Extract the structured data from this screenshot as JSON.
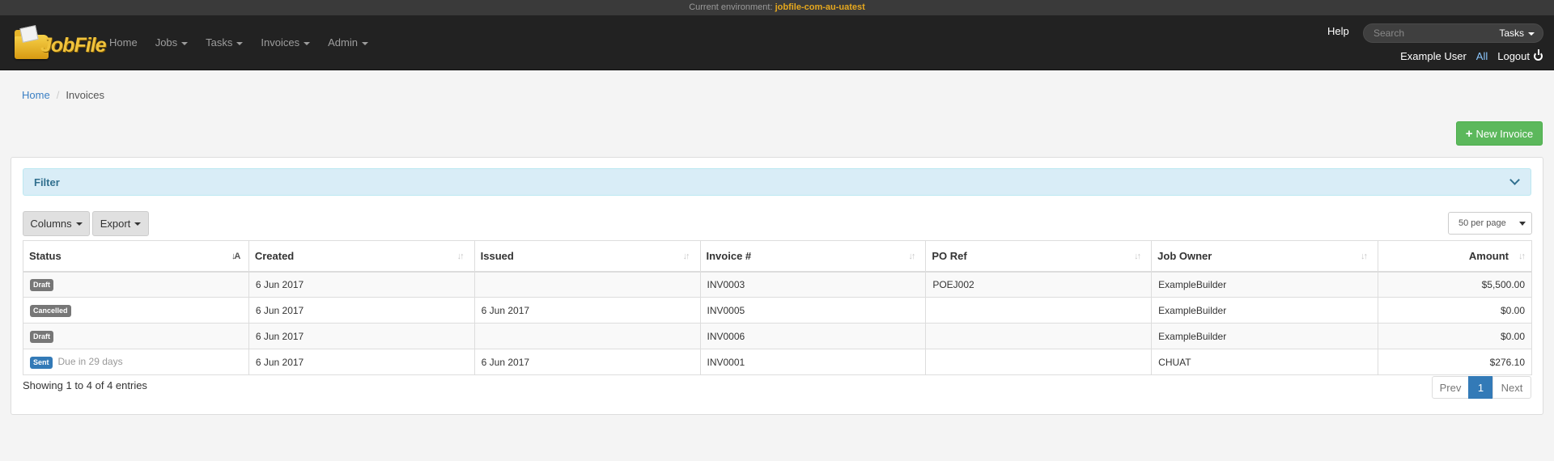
{
  "env": {
    "prefix": "Current environment: ",
    "name": "jobfile-com-au-uatest"
  },
  "brand": {
    "logo_text": "JobFile"
  },
  "nav": {
    "home": "Home",
    "jobs": "Jobs",
    "tasks": "Tasks",
    "invoices": "Invoices",
    "admin": "Admin"
  },
  "help_label": "Help",
  "search": {
    "placeholder": "Search",
    "scope": "Tasks"
  },
  "user": {
    "name": "Example User",
    "all": "All",
    "logout": "Logout"
  },
  "breadcrumb": {
    "home": "Home",
    "current": "Invoices"
  },
  "new_invoice_label": "New Invoice",
  "filter": {
    "title": "Filter"
  },
  "toolbar": {
    "columns": "Columns",
    "export": "Export",
    "per_page": "50 per page"
  },
  "table": {
    "headers": {
      "status": "Status",
      "created": "Created",
      "issued": "Issued",
      "invoice": "Invoice #",
      "po_ref": "PO Ref",
      "job_owner": "Job Owner",
      "amount": "Amount"
    },
    "rows": [
      {
        "status": "Draft",
        "due": "",
        "created": "6 Jun 2017",
        "issued": "",
        "invoice": "INV0003",
        "po_ref": "POEJ002",
        "job_owner": "ExampleBuilder",
        "amount": "$5,500.00"
      },
      {
        "status": "Cancelled",
        "due": "",
        "created": "6 Jun 2017",
        "issued": "6 Jun 2017",
        "invoice": "INV0005",
        "po_ref": "",
        "job_owner": "ExampleBuilder",
        "amount": "$0.00"
      },
      {
        "status": "Draft",
        "due": "",
        "created": "6 Jun 2017",
        "issued": "",
        "invoice": "INV0006",
        "po_ref": "",
        "job_owner": "ExampleBuilder",
        "amount": "$0.00"
      },
      {
        "status": "Sent",
        "due": "Due in 29 days",
        "created": "6 Jun 2017",
        "issued": "6 Jun 2017",
        "invoice": "INV0001",
        "po_ref": "",
        "job_owner": "CHUAT",
        "amount": "$276.10"
      }
    ]
  },
  "footer": {
    "showing": "Showing 1 to 4 of 4 entries"
  },
  "pagination": {
    "prev": "Prev",
    "page": "1",
    "next": "Next"
  },
  "colors": {
    "navbar": "#222222",
    "accent_green": "#5cb85c",
    "link_blue": "#337ab7",
    "env_highlight": "#e6a81e",
    "filter_bg": "#d9edf7"
  }
}
